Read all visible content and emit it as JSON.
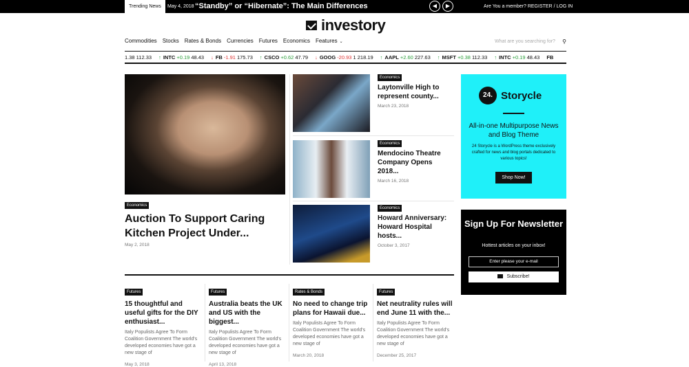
{
  "topbar": {
    "trending_label": "Trending News",
    "trending_date": "May 4, 2018",
    "trending_title": "“Standby” or “Hibernate”: The Main Differences",
    "prev_icon": "arrow-left-icon",
    "next_icon": "arrow-right-icon",
    "member_text": "Are You a member?",
    "register": "REGISTER",
    "separator": "/",
    "login": "LOG IN"
  },
  "brand": {
    "name": "investory"
  },
  "nav": {
    "items": [
      "Commodities",
      "Stocks",
      "Rates & Bonds",
      "Currencies",
      "Futures",
      "Economics",
      "Features"
    ],
    "search_placeholder": "What are you searching for?"
  },
  "ticker": [
    {
      "symbol": "",
      "dir": "",
      "change": "",
      "price": "1.38 112.33"
    },
    {
      "symbol": "INTC",
      "dir": "up",
      "change": "+0.19",
      "price": "48.43"
    },
    {
      "symbol": "FB",
      "dir": "down",
      "change": "-1.91",
      "price": "175.73"
    },
    {
      "symbol": "CSCO",
      "dir": "up",
      "change": "+0.62",
      "price": "47.79"
    },
    {
      "symbol": "GOOG",
      "dir": "down",
      "change": "-20.93",
      "price": "1 218.19"
    },
    {
      "symbol": "AAPL",
      "dir": "up",
      "change": "+2.60",
      "price": "227.63"
    },
    {
      "symbol": "MSFT",
      "dir": "up",
      "change": "+0.38",
      "price": "112.33"
    },
    {
      "symbol": "INTC",
      "dir": "up",
      "change": "+0.19",
      "price": "48.43"
    },
    {
      "symbol": "FB",
      "dir": "",
      "change": "",
      "price": ""
    }
  ],
  "hero": {
    "category": "Economics",
    "title": "Auction To Support Caring Kitchen Project Under...",
    "date": "May 2, 2018"
  },
  "side_articles": [
    {
      "category": "Economics",
      "title": "Laytonville High to represent county...",
      "date": "March 23, 2018"
    },
    {
      "category": "Economics",
      "title": "Mendocino Theatre Company Opens 2018...",
      "date": "March 16, 2018"
    },
    {
      "category": "Economics",
      "title": "Howard Anniversary: Howard Hospital hosts...",
      "date": "October 3, 2017"
    }
  ],
  "cards": [
    {
      "category": "Futures",
      "title": "15 thoughtful and useful gifts for the DIY enthusiast...",
      "excerpt": "Italy Populists Agree To Form Coalition Government The world's developed economies have got a new stage of",
      "date": "May 3, 2018"
    },
    {
      "category": "Futures",
      "title": "Australia beats the UK and US with the biggest...",
      "excerpt": "Italy Populists Agree To Form Coalition Government The world's developed economies have got a new stage of",
      "date": "April 13, 2018"
    },
    {
      "category": "Rates & Bonds",
      "title": "No need to change trip plans for Hawaii due...",
      "excerpt": "Italy Populists Agree To Form Coalition Government The world's developed economies have got a new stage of",
      "date": "March 20, 2018"
    },
    {
      "category": "Futures",
      "title": "Net neutrality rules will end June 11 with the...",
      "excerpt": "Italy Populists Agree To Form Coalition Government The world's developed economies have got a new stage of",
      "date": "December 25, 2017"
    }
  ],
  "ad": {
    "logo_mark": "24.",
    "brand": "Storycle",
    "headline": "All-in-one Multipurpose News and Blog Theme",
    "body": "24 Storycle is a WordPress theme exclusively crafted for news and blog portals dedicated to various topics!",
    "button": "Shop Now!",
    "bg_color": "#1ff0f9"
  },
  "newsletter": {
    "title": "Sign Up For Newsletter",
    "subtitle": "Hottest articles on your inbox!",
    "email_placeholder": "Enter please your e-mail",
    "button": "Subscribe!"
  },
  "colors": {
    "up": "#2a9d3a",
    "down": "#d33"
  }
}
